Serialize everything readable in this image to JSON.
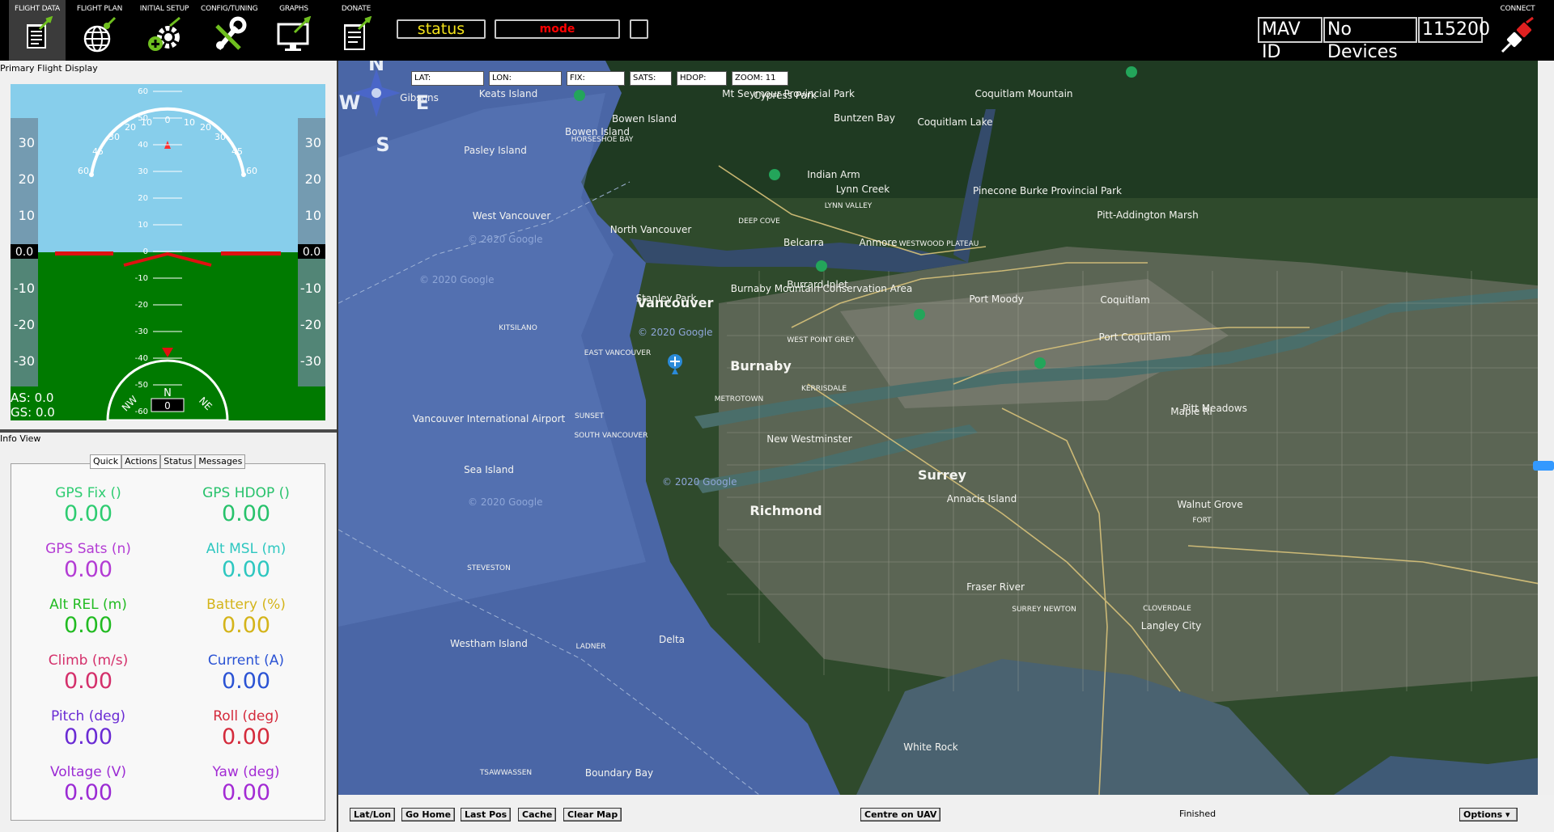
{
  "toolbar": {
    "buttons": [
      {
        "label": "FLIGHT DATA",
        "icon": "flight-data-icon"
      },
      {
        "label": "FLIGHT PLAN",
        "icon": "flight-plan-icon"
      },
      {
        "label": "INITIAL SETUP",
        "icon": "initial-setup-icon"
      },
      {
        "label": "CONFIG/TUNING",
        "icon": "config-tuning-icon"
      },
      {
        "label": "GRAPHS",
        "icon": "graphs-icon"
      },
      {
        "label": "DONATE",
        "icon": "donate-icon"
      }
    ],
    "status": "status",
    "mode": "mode",
    "mav_id": "MAV ID",
    "devices": "No Devices",
    "baud": "115200",
    "connect_label": "CONNECT",
    "colors": {
      "status": "#f4e31a",
      "mode": "#ff0000",
      "accent": "#6fbf1f"
    }
  },
  "pfd": {
    "title": "Primary Flight Display",
    "airspeed": "AS: 0.0",
    "groundspeed": "GS: 0.0",
    "roll_scale": [
      "60",
      "45",
      "30",
      "20",
      "10",
      "0",
      "10",
      "20",
      "30",
      "45",
      "60"
    ],
    "pitch_ladder": [
      "60",
      "50",
      "40",
      "30",
      "20",
      "10",
      "0",
      "-10",
      "-20",
      "-30",
      "-40",
      "-50",
      "-60"
    ],
    "left_tape": [
      "30",
      "20",
      "10",
      "-10",
      "-20",
      "-30"
    ],
    "right_tape": [
      "30",
      "20",
      "10",
      "-10",
      "-20",
      "-30"
    ],
    "left_value": "0.0",
    "right_value": "0.0",
    "heading": "0",
    "compass": {
      "n": "N",
      "nw": "NW",
      "ne": "NE"
    },
    "colors": {
      "sky": "#87ceeb",
      "ground": "#007a00"
    }
  },
  "info": {
    "title": "Info View",
    "tabs": [
      "Quick",
      "Actions",
      "Status",
      "Messages"
    ],
    "quick": [
      {
        "label": "GPS Fix ()",
        "value": "0.00",
        "color": "#2ecc71"
      },
      {
        "label": "GPS HDOP ()",
        "value": "0.00",
        "color": "#27c26b"
      },
      {
        "label": "GPS Sats (n)",
        "value": "0.00",
        "color": "#b33cd4"
      },
      {
        "label": "Alt MSL (m)",
        "value": "0.00",
        "color": "#2ec7c0"
      },
      {
        "label": "Alt REL (m)",
        "value": "0.00",
        "color": "#22bb22"
      },
      {
        "label": "Battery (%)",
        "value": "0.00",
        "color": "#d4b41a"
      },
      {
        "label": "Climb (m/s)",
        "value": "0.00",
        "color": "#d4306b"
      },
      {
        "label": "Current (A)",
        "value": "0.00",
        "color": "#2b53d4"
      },
      {
        "label": "Pitch (deg)",
        "value": "0.00",
        "color": "#6a2bd4"
      },
      {
        "label": "Roll (deg)",
        "value": "0.00",
        "color": "#d42b3c"
      },
      {
        "label": "Voltage (V)",
        "value": "0.00",
        "color": "#9b2bd4"
      },
      {
        "label": "Yaw (deg)",
        "value": "0.00",
        "color": "#a32bd4"
      }
    ]
  },
  "map": {
    "coords": [
      "LAT:",
      "LON:",
      "FIX:",
      "SATS:",
      "HDOP:",
      "ZOOM: 11"
    ],
    "compass": [
      "N",
      "W",
      "E",
      "S"
    ],
    "places": [
      "Gibsons",
      "Keats Island",
      "Bowen Island",
      "Bowen Island",
      "Pasley Island",
      "HORSESHOE BAY",
      "Cypress Park",
      "Mt Seymour Provincial Park",
      "Coquitlam Mountain",
      "Coquitlam Lake",
      "Buntzen Bay",
      "Indian Arm",
      "Lynn Creek",
      "LYNN VALLEY",
      "West Vancouver",
      "North Vancouver",
      "DEEP COVE",
      "Belcarra",
      "Anmore",
      "WESTWOOD PLATEAU",
      "Pinecone Burke Provincial Park",
      "Pitt-Addington Marsh",
      "Burrard Inlet",
      "Stanley Park",
      "Vancouver",
      "Burnaby Mountain Conservation Area",
      "Port Moody",
      "Coquitlam",
      "KITSILANO",
      "WEST POINT GREY",
      "EAST VANCOUVER",
      "Port Coquitlam",
      "Burnaby",
      "KERRISDALE",
      "METROTOWN",
      "Vancouver International Airport",
      "SUNSET",
      "SOUTH VANCOUVER",
      "Pitt Meadows",
      "Maple Ri",
      "New Westminster",
      "Sea Island",
      "Surrey",
      "Walnut Grove",
      "FORT",
      "Richmond",
      "Annacis Island",
      "STEVESTON",
      "SURREY NEWTON",
      "CLOVERDALE",
      "Langley City",
      "Westham Island",
      "LADNER",
      "Delta",
      "White Rock",
      "TSAWWASSEN",
      "Boundary Bay",
      "Fraser River"
    ],
    "watermark": "© 2020 Google",
    "buttons": [
      "Lat/Lon",
      "Go Home",
      "Last Pos",
      "Cache",
      "Clear Map"
    ],
    "centre": "Centre on UAV",
    "status": "Finished",
    "options": "Options"
  }
}
